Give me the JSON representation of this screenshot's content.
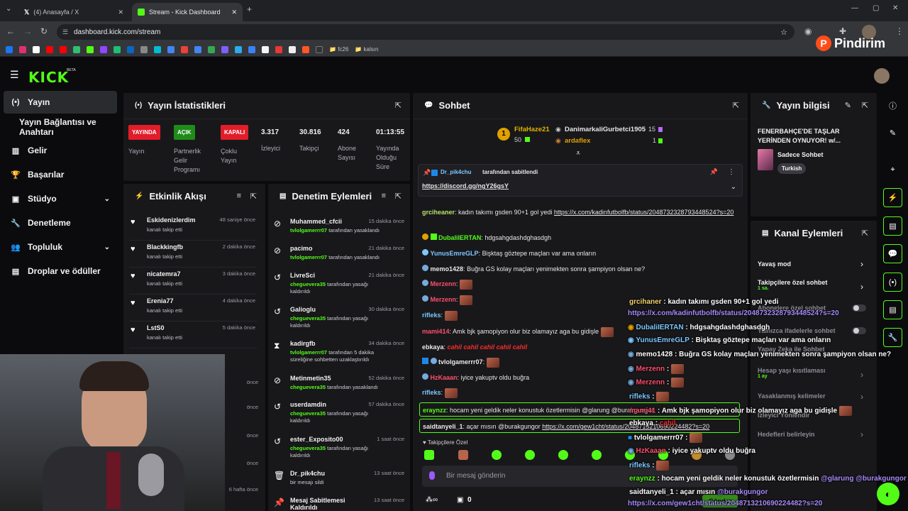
{
  "browser": {
    "tabs": [
      {
        "title": "(4) Anasayfa / X"
      },
      {
        "title": "Stream - Kick Dashboard"
      }
    ],
    "url": "dashboard.kick.com/stream",
    "bookmarks": [
      "fc26",
      "kalsın"
    ],
    "watermark": "Pindirim"
  },
  "app": {
    "logo": "KICK",
    "beta": "BETA"
  },
  "sidebar": {
    "items": [
      {
        "label": "Yayın",
        "icon": "broadcast-icon"
      },
      {
        "label": "Yayın Bağlantısı ve Anahtarı",
        "icon": ""
      },
      {
        "label": "Gelir",
        "icon": "chart-icon"
      },
      {
        "label": "Başarılar",
        "icon": "trophy-icon"
      },
      {
        "label": "Stüdyo",
        "icon": "studio-icon"
      },
      {
        "label": "Denetleme",
        "icon": "wrench-icon"
      },
      {
        "label": "Topluluk",
        "icon": "people-icon"
      },
      {
        "label": "Droplar ve ödüller",
        "icon": "gift-icon"
      }
    ]
  },
  "stats": {
    "title": "Yayın İstatistikleri",
    "badges": [
      {
        "badge": "YAYINDA",
        "label": "Yayın",
        "color": "#e11d2a"
      },
      {
        "badge": "AÇIK",
        "label": "Partnerlik Gelir Programı",
        "color": "#1f8b1a"
      },
      {
        "badge": "KAPALI",
        "label": "Çoklu Yayın",
        "color": "#e11d2a"
      }
    ],
    "values": [
      {
        "value": "3.317",
        "label": "İzleyici"
      },
      {
        "value": "30.816",
        "label": "Takipçi"
      },
      {
        "value": "424",
        "label": "Abone Sayısı"
      },
      {
        "value": "01:13:55",
        "label": "Yayında Olduğu Süre"
      }
    ]
  },
  "activity": {
    "title": "Etkinlik Akışı",
    "items": [
      {
        "name": "Eskidenizlerdim",
        "sub": "kanalı takip etti",
        "time": "48 saniye önce"
      },
      {
        "name": "Blackkingfb",
        "sub": "kanalı takip etti",
        "time": "2 dakika önce"
      },
      {
        "name": "nicatemra7",
        "sub": "kanalı takip etti",
        "time": "3 dakika önce"
      },
      {
        "name": "Erenia77",
        "sub": "kanalı takip etti",
        "time": "4 dakika önce"
      },
      {
        "name": "LstS0",
        "sub": "kanalı takip etti",
        "time": "5 dakika önce"
      }
    ],
    "partial_times": [
      "önce",
      "önce",
      "önce",
      "önce",
      "6 hafta önce"
    ]
  },
  "moderation": {
    "title": "Denetim Eylemleri",
    "items": [
      {
        "name": "Muhammed_cfcii",
        "mod": "tvlolgamerrr07",
        "action": "tarafından yasaklandı",
        "time": "15 dakika önce",
        "icon": "ban-icon"
      },
      {
        "name": "pacimo",
        "mod": "tvlolgamerrr07",
        "action": "tarafından yasaklandı",
        "time": "21 dakika önce",
        "icon": "ban-icon"
      },
      {
        "name": "LivreSci",
        "mod": "cheguevera35",
        "action": "tarafından yasağı kaldırıldı",
        "time": "21 dakika önce",
        "icon": "undo-icon"
      },
      {
        "name": "Galioglu",
        "mod": "cheguevera35",
        "action": "tarafından yasağı kaldırıldı",
        "time": "30 dakika önce",
        "icon": "undo-icon"
      },
      {
        "name": "kadirgfb",
        "mod": "tvlolgamerrr07",
        "action": "tarafından 5 dakika süreliğine sohbetten uzaklaştırıldı",
        "time": "34 dakika önce",
        "icon": "hourglass-icon"
      },
      {
        "name": "Metinmetin35",
        "mod": "cheguevera35",
        "action": "tarafından yasaklandı",
        "time": "52 dakika önce",
        "icon": "ban-icon"
      },
      {
        "name": "userdamdin",
        "mod": "cheguevera35",
        "action": "tarafından yasağı kaldırıldı",
        "time": "57 dakika önce",
        "icon": "undo-icon"
      },
      {
        "name": "ester_Exposito00",
        "mod": "cheguevera35",
        "action": "tarafından yasağı kaldırıldı",
        "time": "1 saat önce",
        "icon": "undo-icon"
      },
      {
        "name": "Dr_pik4chu",
        "mod": "",
        "action": "bir mesajı sildi",
        "time": "13 saat önce",
        "icon": "trash-icon"
      },
      {
        "name": "Mesaj Sabitlemesi Kaldırıldı",
        "mod": "",
        "action": "",
        "time": "13 saat önce",
        "icon": "unpin-icon"
      }
    ]
  },
  "chat": {
    "title": "Sohbet",
    "leaderboard": [
      {
        "name": "FifaHaze21",
        "value": "50"
      },
      {
        "name": "DanimarkaliGurbetci1905",
        "value": "15"
      },
      {
        "name": "ardaflex",
        "value": "1"
      }
    ],
    "pinned": {
      "by": "Dr_pik4chu",
      "label": "tarafından sabitlendi",
      "link": "https://discord.gg/ngY26gsY"
    },
    "messages": [
      {
        "user": "grciheaner",
        "color": "#b6e36b",
        "text": "kadın takımı gsden 90+1 gol yedi",
        "link": "https://x.com/kadinfutbolfb/status/2048732328793448524?s=20"
      },
      {
        "user": "DubaliIERTAN",
        "color": "#53fc18",
        "text": "hdgsahgdashdghasdgh"
      },
      {
        "user": "YunusEmreGLP",
        "color": "#7cc7ff",
        "text": "Bişktaş göztepe maçları var ama onların"
      },
      {
        "user": "memo1428",
        "color": "#e8e8e8",
        "text": "Buğra GS kolay maçları yenimekten sonra şampiyon olsan ne?"
      },
      {
        "user": "Merzenn",
        "color": "#ff4d6d",
        "text": ""
      },
      {
        "user": "Merzenn",
        "color": "#ff4d6d",
        "text": ""
      },
      {
        "user": "rifleks",
        "color": "#7cc7ff",
        "text": ""
      },
      {
        "user": "mami414",
        "color": "#ff4d6d",
        "text": "Amk bjk şamopiyon olur biz olamayız aga bu gidişle"
      },
      {
        "user": "ebkaya",
        "color": "#e8e8e8",
        "text": "cahil cahil cahil cahil cahil"
      },
      {
        "user": "tvlolgamerrr07",
        "color": "#e8e8e8",
        "text": ""
      },
      {
        "user": "HzKaaan",
        "color": "#ff4d6d",
        "text": "iyice yakuptv oldu buğra"
      },
      {
        "user": "rifleks",
        "color": "#7cc7ff",
        "text": ""
      },
      {
        "user": "eraynzz",
        "color": "#53fc18",
        "text": "hocam yeni geldik neler konustuk özetlermisin @glarung @burakgungor"
      },
      {
        "user": "saidtanyeli_1",
        "color": "#e8e8e8",
        "text": "açar mısın @burakgungor",
        "link": "https://x.com/gew1cht/status/2048713210690224482?s=20"
      }
    ],
    "followers_only": "Takipçilere Özel",
    "input_placeholder": "Bir mesaj gönderin",
    "footer_count": "0",
    "send_label": "Gönder"
  },
  "overlay_chat": [
    {
      "user": "grcihaner",
      "text": "kadın takımı gsden 90+1 gol yedi",
      "link": "https://x.com/kadinfutbolfb/status/2048732328793448524?s=20"
    },
    {
      "user": "DubaliIERTAN",
      "text": "hdgsahgdashdghasdgh"
    },
    {
      "user": "YunusEmreGLP",
      "text": "Bişktaş göztepe maçları var ama onların"
    },
    {
      "user": "memo1428",
      "text": "Buğra GS kolay maçları yenimekten sonra şampiyon olsan ne?"
    },
    {
      "user": "Merzenn",
      "text": ""
    },
    {
      "user": "Merzenn",
      "text": ""
    },
    {
      "user": "rifleks",
      "text": ""
    },
    {
      "user": "mami41",
      "text": "Amk bjk şamopiyon olur biz olamayız aga bu gidişle"
    },
    {
      "user": "ebkaya",
      "text": "cahil"
    },
    {
      "user": "tvlolgamerrr07",
      "text": ""
    },
    {
      "user": "HzKaaan",
      "text": "iyice yakuptv oldu buğra"
    },
    {
      "user": "rifleks",
      "text": ""
    },
    {
      "user": "eraynzz",
      "text": "hocam yeni geldik neler konustuk özetlermisin",
      "mention": "@glarung @burakgungor"
    },
    {
      "user": "saidtanyeli_1",
      "text": "açar mısın",
      "mention": "@burakgungor",
      "link": "https://x.com/gew1cht/status/2048713210690224482?s=20"
    }
  ],
  "stream_info": {
    "title": "Yayın bilgisi",
    "stream_title": "FENERBAHÇE'DE TAŞLAR YERİNDEN OYNUYOR! w/...",
    "category": "Sadece Sohbet",
    "tag": "Turkish"
  },
  "channel_actions": {
    "title": "Kanal Eylemleri",
    "items": [
      {
        "label": "Yavaş mod",
        "sub": "",
        "control": "arrow"
      },
      {
        "label": "Takipçilere özel sohbet",
        "sub": "1 sa.",
        "control": "arrow"
      },
      {
        "label": "Abonelere özel sohbet",
        "sub": "",
        "control": "toggle"
      },
      {
        "label": "Yalnızca ifadelerle sohbet",
        "sub": "",
        "control": "toggle"
      },
      {
        "label": "Yapay Zeka ile Sohbet",
        "sub": "",
        "control": ""
      },
      {
        "label": "Hesap yaşı kısıtlaması",
        "sub": "1 ay",
        "control": "arrow"
      },
      {
        "label": "Yasaklanmış kelimeler",
        "sub": "",
        "control": "arrow"
      },
      {
        "label": "İzleyici Yönlendir",
        "sub": "",
        "control": ""
      },
      {
        "label": "Hedefleri belirleyin",
        "sub": "",
        "control": "arrow"
      }
    ]
  },
  "colors": {
    "accent": "#53fc18",
    "panel": "#18181b",
    "live": "#e11d2a"
  }
}
